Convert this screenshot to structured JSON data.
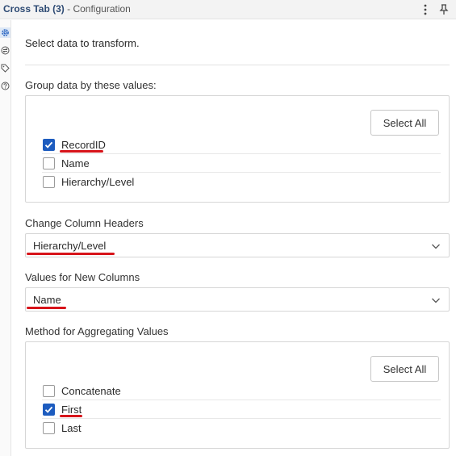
{
  "titlebar": {
    "tool_name": "Cross Tab (3)",
    "subtitle": " - Configuration",
    "more_icon": "more-vertical-icon",
    "pin_icon": "pin-icon"
  },
  "rail": {
    "icons": [
      "gear-icon",
      "arrows-icon",
      "tag-icon",
      "help-icon"
    ]
  },
  "intro_text": "Select data to transform.",
  "group_section": {
    "label": "Group data by these values:",
    "select_all": "Select All",
    "items": [
      {
        "label": "RecordID",
        "checked": true
      },
      {
        "label": "Name",
        "checked": false
      },
      {
        "label": "Hierarchy/Level",
        "checked": false
      }
    ]
  },
  "column_headers": {
    "label": "Change Column Headers",
    "value": "Hierarchy/Level"
  },
  "new_columns": {
    "label": "Values for New Columns",
    "value": "Name"
  },
  "aggregation": {
    "label": "Method for Aggregating Values",
    "select_all": "Select All",
    "items": [
      {
        "label": "Concatenate",
        "checked": false
      },
      {
        "label": "First",
        "checked": true
      },
      {
        "label": "Last",
        "checked": false
      }
    ]
  },
  "colors": {
    "accent": "#1d5cbf",
    "annotation": "#d7141a"
  }
}
